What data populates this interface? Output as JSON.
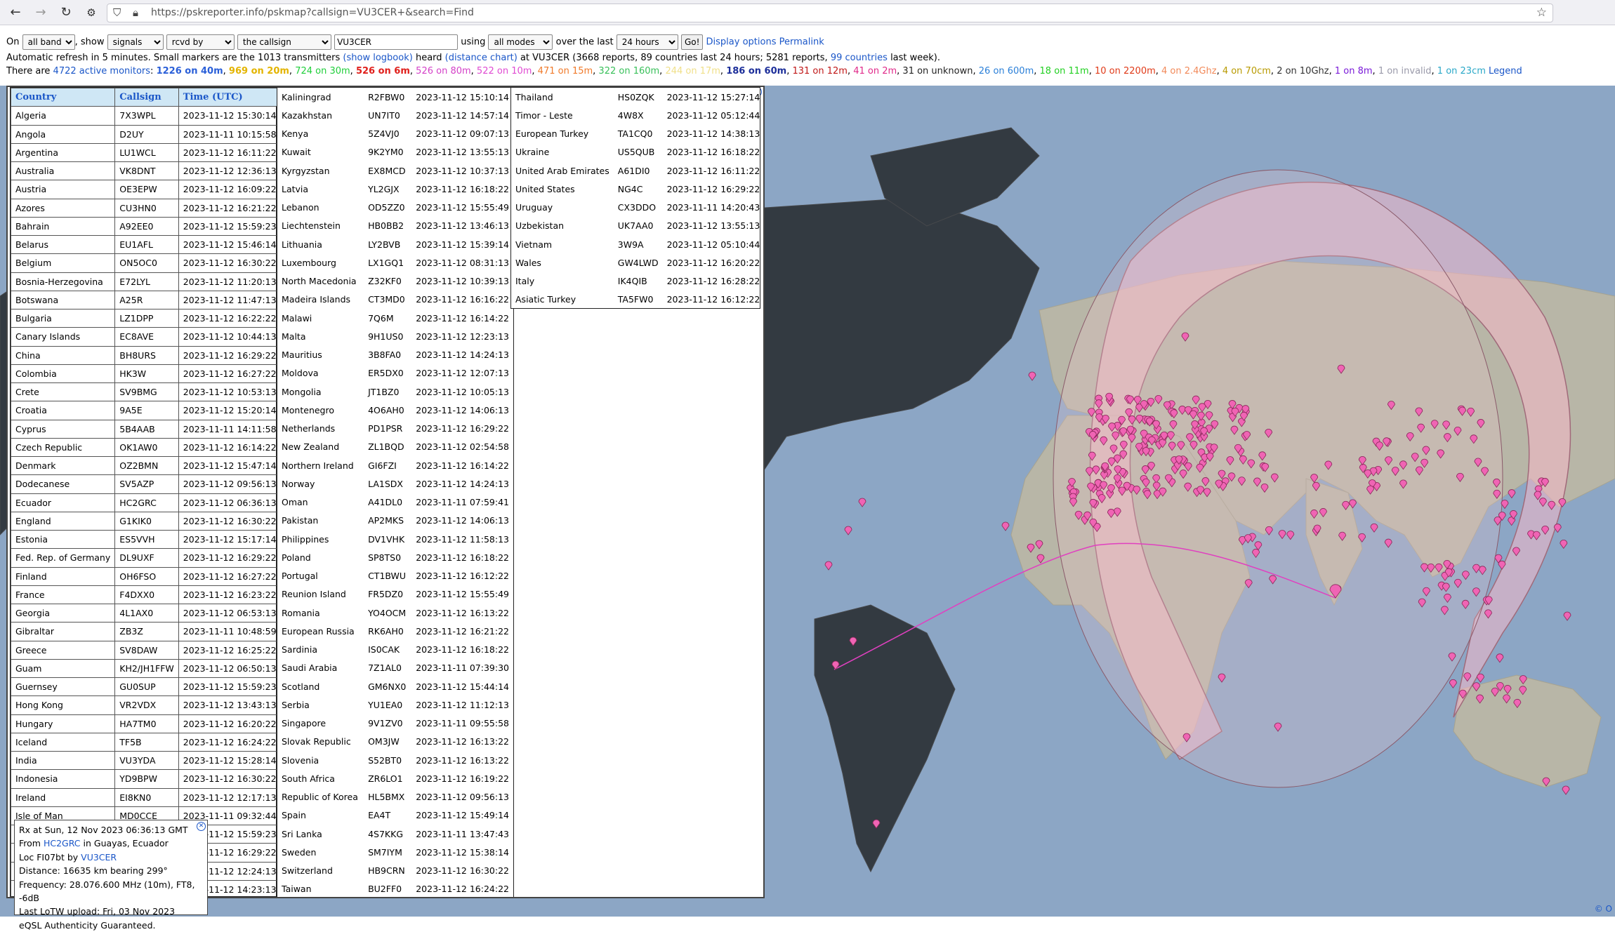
{
  "browser": {
    "url": "https://pskreporter.info/pskmap?callsign=VU3CER+&search=Find"
  },
  "controls": {
    "on_label": "On",
    "bands": "all bands",
    "show_label": ", show",
    "show": "signals",
    "direction": "rcvd by",
    "target": "the callsign",
    "callsign": "VU3CER",
    "using_label": "using",
    "modes": "all modes",
    "over_label": "over the last",
    "period": "24 hours",
    "go": "Go!",
    "display_options": "Display options",
    "permalink": "Permalink"
  },
  "refresh_line": {
    "text1": "Automatic refresh in 5 minutes. Small markers are the 1013 transmitters",
    "show_logbook": "(show logbook)",
    "text2": "heard",
    "distance_chart": "(distance chart)",
    "text3": "at VU3CER (3668 reports, 89 countries last 24 hours; 5281 reports,",
    "countries_link": "99 countries",
    "text4": "last week)."
  },
  "monitors": {
    "prefix": "There are",
    "active": "4722 active monitors",
    "colon": ":",
    "bands": [
      {
        "text": "1226 on 40m",
        "color": "#2a5fd8",
        "bold": true
      },
      {
        "text": "969 on 20m",
        "color": "#e3b400",
        "bold": true
      },
      {
        "text": "724 on 30m",
        "color": "#1fcf3a",
        "bold": false
      },
      {
        "text": "526 on 6m",
        "color": "#e0201c",
        "bold": true
      },
      {
        "text": "526 on 80m",
        "color": "#d441c8",
        "bold": false
      },
      {
        "text": "522 on 10m",
        "color": "#e04ad2",
        "bold": false
      },
      {
        "text": "471 on 15m",
        "color": "#f07a2a",
        "bold": false
      },
      {
        "text": "322 on 160m",
        "color": "#39c05a",
        "bold": false
      },
      {
        "text": "244 on 17m",
        "color": "#f0e08a",
        "bold": false
      },
      {
        "text": "186 on 60m",
        "color": "#1d2f9a",
        "bold": true
      },
      {
        "text": "131 on 12m",
        "color": "#c01818",
        "bold": false
      },
      {
        "text": "41 on 2m",
        "color": "#e02a8a",
        "bold": false
      },
      {
        "text": "31 on unknown",
        "color": "#222222",
        "bold": false
      },
      {
        "text": "26 on 600m",
        "color": "#2a7fd8",
        "bold": false
      },
      {
        "text": "18 on 11m",
        "color": "#22d022",
        "bold": false
      },
      {
        "text": "10 on 2200m",
        "color": "#e03a18",
        "bold": false
      },
      {
        "text": "4 on 2.4Ghz",
        "color": "#f28a5a",
        "bold": false
      },
      {
        "text": "4 on 70cm",
        "color": "#b89a00",
        "bold": false
      },
      {
        "text": "2 on 10Ghz",
        "color": "#333333",
        "bold": false
      },
      {
        "text": "1 on 8m",
        "color": "#7a1ad8",
        "bold": false
      },
      {
        "text": "1 on invalid",
        "color": "#9a9aaa",
        "bold": false
      },
      {
        "text": "1 on 23cm",
        "color": "#2aa8c8",
        "bold": false
      }
    ],
    "legend": "Legend"
  },
  "table": {
    "headers": {
      "country": "Country",
      "callsign": "Callsign",
      "time": "Time (UTC)"
    },
    "col1": [
      [
        "Algeria",
        "7X3WPL",
        "2023-11-12 15:30:14"
      ],
      [
        "Angola",
        "D2UY",
        "2023-11-11 10:15:58"
      ],
      [
        "Argentina",
        "LU1WCL",
        "2023-11-12 16:11:22"
      ],
      [
        "Australia",
        "VK8DNT",
        "2023-11-12 12:36:13"
      ],
      [
        "Austria",
        "OE3EPW",
        "2023-11-12 16:09:22"
      ],
      [
        "Azores",
        "CU3HN0",
        "2023-11-12 16:21:22"
      ],
      [
        "Bahrain",
        "A92EE0",
        "2023-11-12 15:59:23"
      ],
      [
        "Belarus",
        "EU1AFL",
        "2023-11-12 15:46:14"
      ],
      [
        "Belgium",
        "ON5OC0",
        "2023-11-12 16:30:22"
      ],
      [
        "Bosnia-Herzegovina",
        "E72LYL",
        "2023-11-12 11:20:13"
      ],
      [
        "Botswana",
        "A25R",
        "2023-11-12 11:47:13"
      ],
      [
        "Bulgaria",
        "LZ1DPP",
        "2023-11-12 16:22:22"
      ],
      [
        "Canary Islands",
        "EC8AVE",
        "2023-11-12 10:44:13"
      ],
      [
        "China",
        "BH8URS",
        "2023-11-12 16:29:22"
      ],
      [
        "Colombia",
        "HK3W",
        "2023-11-12 16:27:22"
      ],
      [
        "Crete",
        "SV9BMG",
        "2023-11-12 10:53:13"
      ],
      [
        "Croatia",
        "9A5E",
        "2023-11-12 15:20:14"
      ],
      [
        "Cyprus",
        "5B4AAB",
        "2023-11-11 14:11:58"
      ],
      [
        "Czech Republic",
        "OK1AW0",
        "2023-11-12 16:14:22"
      ],
      [
        "Denmark",
        "OZ2BMN",
        "2023-11-12 15:47:14"
      ],
      [
        "Dodecanese",
        "SV5AZP",
        "2023-11-12 09:56:13"
      ],
      [
        "Ecuador",
        "HC2GRC",
        "2023-11-12 06:36:13"
      ],
      [
        "England",
        "G1KIK0",
        "2023-11-12 16:30:22"
      ],
      [
        "Estonia",
        "ES5VVH",
        "2023-11-12 15:17:14"
      ],
      [
        "Fed. Rep. of Germany",
        "DL9UXF",
        "2023-11-12 16:29:22"
      ],
      [
        "Finland",
        "OH6FSO",
        "2023-11-12 16:27:22"
      ],
      [
        "France",
        "F4DXX0",
        "2023-11-12 16:23:22"
      ],
      [
        "Georgia",
        "4L1AX0",
        "2023-11-12 06:53:13"
      ],
      [
        "Gibraltar",
        "ZB3Z",
        "2023-11-11 10:48:59"
      ],
      [
        "Greece",
        "SV8DAW",
        "2023-11-12 16:25:22"
      ],
      [
        "Guam",
        "KH2/JH1FFW",
        "2023-11-12 06:50:13"
      ],
      [
        "Guernsey",
        "GU0SUP",
        "2023-11-12 15:59:23"
      ],
      [
        "Hong Kong",
        "VR2VDX",
        "2023-11-12 13:43:13"
      ],
      [
        "Hungary",
        "HA7TM0",
        "2023-11-12 16:20:22"
      ],
      [
        "Iceland",
        "TF5B",
        "2023-11-12 16:24:22"
      ],
      [
        "India",
        "VU3YDA",
        "2023-11-12 15:28:14"
      ],
      [
        "Indonesia",
        "YD9BPW",
        "2023-11-12 16:30:22"
      ],
      [
        "Ireland",
        "EI8KN0",
        "2023-11-12 12:17:13"
      ],
      [
        "Isle of Man",
        "MD0CCE",
        "2023-11-11 09:32:44"
      ],
      [
        "",
        "",
        "2023-11-12 15:59:23"
      ],
      [
        "",
        "",
        "2023-11-12 16:29:22"
      ],
      [
        "",
        "",
        "2023-11-12 12:24:13"
      ],
      [
        "",
        "",
        "2023-11-12 14:23:13"
      ]
    ],
    "col2": [
      [
        "Kaliningrad",
        "R2FBW0",
        "2023-11-12 15:10:14"
      ],
      [
        "Kazakhstan",
        "UN7IT0",
        "2023-11-12 14:57:14"
      ],
      [
        "Kenya",
        "5Z4VJ0",
        "2023-11-12 09:07:13"
      ],
      [
        "Kuwait",
        "9K2YM0",
        "2023-11-12 13:55:13"
      ],
      [
        "Kyrgyzstan",
        "EX8MCD",
        "2023-11-12 10:37:13"
      ],
      [
        "Latvia",
        "YL2GJX",
        "2023-11-12 16:18:22"
      ],
      [
        "Lebanon",
        "OD5ZZ0",
        "2023-11-12 15:55:49"
      ],
      [
        "Liechtenstein",
        "HB0BB2",
        "2023-11-12 13:46:13"
      ],
      [
        "Lithuania",
        "LY2BVB",
        "2023-11-12 15:39:14"
      ],
      [
        "Luxembourg",
        "LX1GQ1",
        "2023-11-12 08:31:13"
      ],
      [
        "North Macedonia",
        "Z32KF0",
        "2023-11-12 10:39:13"
      ],
      [
        "Madeira Islands",
        "CT3MD0",
        "2023-11-12 16:16:22"
      ],
      [
        "Malawi",
        "7Q6M",
        "2023-11-12 16:14:22"
      ],
      [
        "Malta",
        "9H1US0",
        "2023-11-12 12:23:13"
      ],
      [
        "Mauritius",
        "3B8FA0",
        "2023-11-12 14:24:13"
      ],
      [
        "Moldova",
        "ER5DX0",
        "2023-11-12 12:07:13"
      ],
      [
        "Mongolia",
        "JT1BZ0",
        "2023-11-12 10:05:13"
      ],
      [
        "Montenegro",
        "4O6AH0",
        "2023-11-12 14:06:13"
      ],
      [
        "Netherlands",
        "PD1PSR",
        "2023-11-12 16:29:22"
      ],
      [
        "New Zealand",
        "ZL1BQD",
        "2023-11-12 02:54:58"
      ],
      [
        "Northern Ireland",
        "GI6FZI",
        "2023-11-12 16:14:22"
      ],
      [
        "Norway",
        "LA1SDX",
        "2023-11-12 14:24:13"
      ],
      [
        "Oman",
        "A41DL0",
        "2023-11-11 07:59:41"
      ],
      [
        "Pakistan",
        "AP2MKS",
        "2023-11-12 14:06:13"
      ],
      [
        "Philippines",
        "DV1VHK",
        "2023-11-12 11:58:13"
      ],
      [
        "Poland",
        "SP8TS0",
        "2023-11-12 16:18:22"
      ],
      [
        "Portugal",
        "CT1BWU",
        "2023-11-12 16:12:22"
      ],
      [
        "Reunion Island",
        "FR5DZ0",
        "2023-11-12 15:55:49"
      ],
      [
        "Romania",
        "YO4OCM",
        "2023-11-12 16:13:22"
      ],
      [
        "European Russia",
        "RK6AH0",
        "2023-11-12 16:21:22"
      ],
      [
        "Sardinia",
        "IS0CAK",
        "2023-11-12 16:18:22"
      ],
      [
        "Saudi Arabia",
        "7Z1AL0",
        "2023-11-11 07:39:30"
      ],
      [
        "Scotland",
        "GM6NX0",
        "2023-11-12 15:44:14"
      ],
      [
        "Serbia",
        "YU1EA0",
        "2023-11-12 11:12:13"
      ],
      [
        "Singapore",
        "9V1ZV0",
        "2023-11-11 09:55:58"
      ],
      [
        "Slovak Republic",
        "OM3JW",
        "2023-11-12 16:13:22"
      ],
      [
        "Slovenia",
        "S52BT0",
        "2023-11-12 16:13:22"
      ],
      [
        "South Africa",
        "ZR6LO1",
        "2023-11-12 16:19:22"
      ],
      [
        "Republic of Korea",
        "HL5BMX",
        "2023-11-12 09:56:13"
      ],
      [
        "Spain",
        "EA4T",
        "2023-11-12 15:49:14"
      ],
      [
        "Sri Lanka",
        "4S7KKG",
        "2023-11-11 13:47:43"
      ],
      [
        "Sweden",
        "SM7IYM",
        "2023-11-12 15:38:14"
      ],
      [
        "Switzerland",
        "HB9CRN",
        "2023-11-12 16:30:22"
      ],
      [
        "Taiwan",
        "BU2FF0",
        "2023-11-12 16:24:22"
      ]
    ],
    "col3": [
      [
        "Thailand",
        "HS0ZQK",
        "2023-11-12 15:27:14"
      ],
      [
        "Timor - Leste",
        "4W8X",
        "2023-11-12 05:12:44"
      ],
      [
        "European Turkey",
        "TA1CQ0",
        "2023-11-12 14:38:13"
      ],
      [
        "Ukraine",
        "US5QUB",
        "2023-11-12 16:18:22"
      ],
      [
        "United Arab Emirates",
        "A61DI0",
        "2023-11-12 16:11:22"
      ],
      [
        "United States",
        "NG4C",
        "2023-11-12 16:29:22"
      ],
      [
        "Uruguay",
        "CX3DDO",
        "2023-11-11 14:20:43"
      ],
      [
        "Uzbekistan",
        "UK7AA0",
        "2023-11-12 13:55:13"
      ],
      [
        "Vietnam",
        "3W9A",
        "2023-11-12 05:10:44"
      ],
      [
        "Wales",
        "GW4LWD",
        "2023-11-12 16:20:22"
      ],
      [
        "Italy",
        "IK4QIB",
        "2023-11-12 16:28:22"
      ],
      [
        "Asiatic Turkey",
        "TA5FW0",
        "2023-11-12 16:12:22"
      ]
    ]
  },
  "popup": {
    "line1": "Rx at Sun, 12 Nov 2023 06:36:13 GMT",
    "from_label": "From",
    "from_call": "HC2GRC",
    "from_place": "in Guayas, Ecuador",
    "loc_label": "Loc FI07bt by",
    "by_call": "VU3CER",
    "distance": "Distance: 16635 km bearing 299°",
    "frequency": "Frequency: 28.076.600 MHz (10m), FT8, -6dB",
    "lotw": "Last LoTW upload: Fri, 03 Nov 2023",
    "eqsl": "eQSL Authenticity Guaranteed."
  },
  "map": {
    "credit": "© O",
    "marker_color": "#f064b4"
  }
}
